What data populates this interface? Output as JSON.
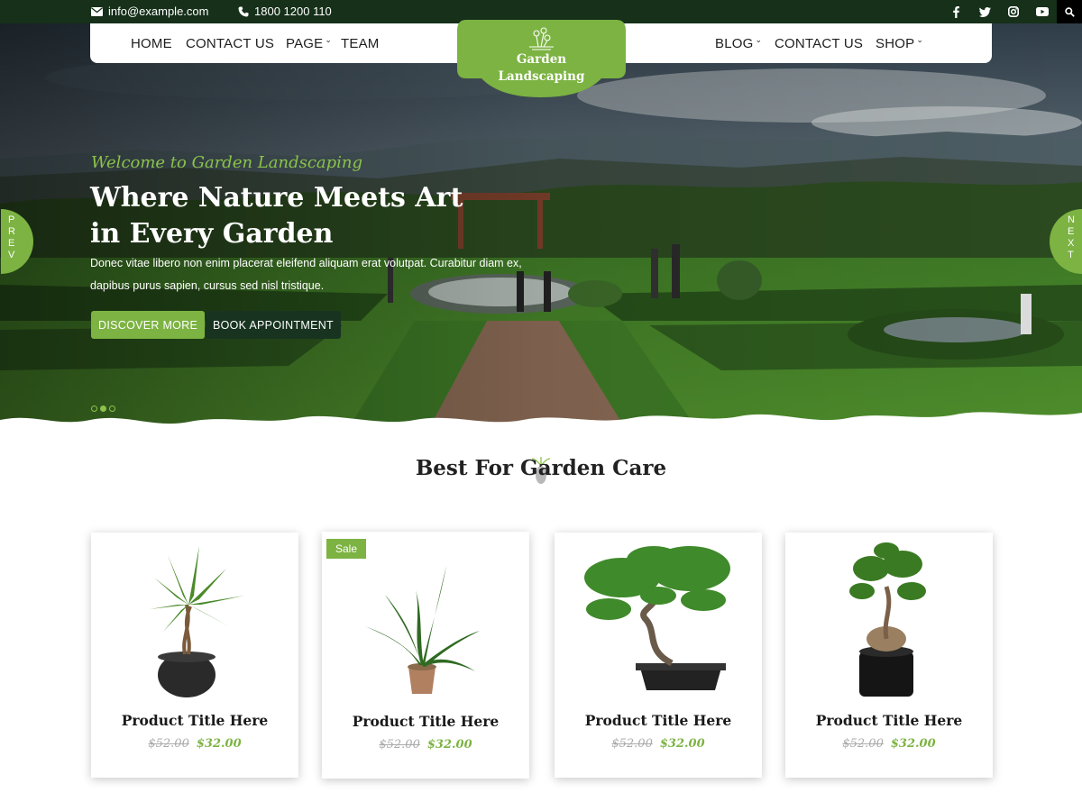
{
  "topbar": {
    "email": "info@example.com",
    "phone": "1800 1200 110",
    "socials": [
      "facebook-icon",
      "twitter-icon",
      "instagram-icon",
      "youtube-icon"
    ]
  },
  "nav": {
    "left": [
      "HOME",
      "CONTACT US",
      "PAGE",
      "TEAM"
    ],
    "right": [
      "BLOG",
      "CONTACT US",
      "SHOP"
    ],
    "dropdown_items": [
      "PAGE",
      "BLOG",
      "SHOP"
    ]
  },
  "logo": {
    "line1": "Garden",
    "line2": "Landscaping"
  },
  "hero": {
    "tagline": "Welcome to Garden Landscaping",
    "title_line1": "Where Nature Meets Art",
    "title_line2": "in Every Garden",
    "description": "Donec vitae libero non enim placerat eleifend aliquam erat volutpat. Curabitur diam ex, dapibus purus sapien, cursus sed nisl tristique.",
    "btn_discover": "DISCOVER MORE",
    "btn_book": "BOOK APPOINTMENT",
    "prev_label": "PREV",
    "next_label": "NEXT",
    "slides": 3,
    "active_slide": 2
  },
  "section": {
    "title": "Best For Garden Care"
  },
  "products": [
    {
      "title": "Product Title Here",
      "old_price": "$52.00",
      "new_price": "$32.00",
      "badge": ""
    },
    {
      "title": "Product Title Here",
      "old_price": "$52.00",
      "new_price": "$32.00",
      "badge": "Sale"
    },
    {
      "title": "Product Title Here",
      "old_price": "$52.00",
      "new_price": "$32.00",
      "badge": ""
    },
    {
      "title": "Product Title Here",
      "old_price": "$52.00",
      "new_price": "$32.00",
      "badge": ""
    }
  ],
  "colors": {
    "accent": "#7cb342",
    "dark": "#16301a"
  }
}
